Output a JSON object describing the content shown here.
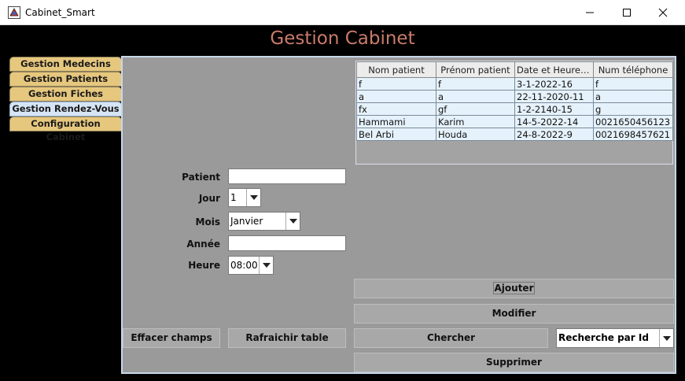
{
  "window": {
    "title": "Cabinet_Smart",
    "minimize_glyph": "—",
    "maximize_glyph": "☐",
    "close_glyph": "✕"
  },
  "heading": "Gestion Cabinet",
  "tabs": [
    {
      "label": "Gestion Medecins"
    },
    {
      "label": "Gestion Patients"
    },
    {
      "label": "Gestion Fiches"
    },
    {
      "label": "Gestion Rendez-Vous"
    },
    {
      "label": "Configuration Cabinet"
    }
  ],
  "table": {
    "headers": [
      "Nom patient",
      "Prénom patient",
      "Date et Heure pr...",
      "Num téléphone"
    ],
    "rows": [
      [
        "f",
        "f",
        "3-1-2022-16",
        "f"
      ],
      [
        "a",
        "a",
        "22-11-2020-11",
        "a"
      ],
      [
        "fx",
        "gf",
        "1-2-2140-15",
        "g"
      ],
      [
        "Hammami",
        "Karim",
        "14-5-2022-14",
        "0021650456123"
      ],
      [
        "Bel Arbi",
        "Houda",
        "24-8-2022-9",
        "0021698457621"
      ]
    ]
  },
  "form": {
    "patient_label": "Patient",
    "patient_value": "",
    "jour_label": "Jour",
    "jour_value": "1",
    "mois_label": "Mois",
    "mois_value": "Janvier",
    "annee_label": "Année",
    "annee_value": "",
    "heure_label": "Heure",
    "heure_value": "08:00"
  },
  "buttons": {
    "ajouter": "Ajouter",
    "modifier": "Modifier",
    "effacer": "Effacer champs",
    "rafraichir": "Rafraichir table",
    "chercher": "Chercher",
    "supprimer": "Supprimer"
  },
  "search_mode": "Recherche par Id",
  "colors": {
    "heading": "#c97b6b",
    "tab": "#e6c77e",
    "tab_active": "#d6e5f5",
    "panel": "#9a9a9a"
  }
}
